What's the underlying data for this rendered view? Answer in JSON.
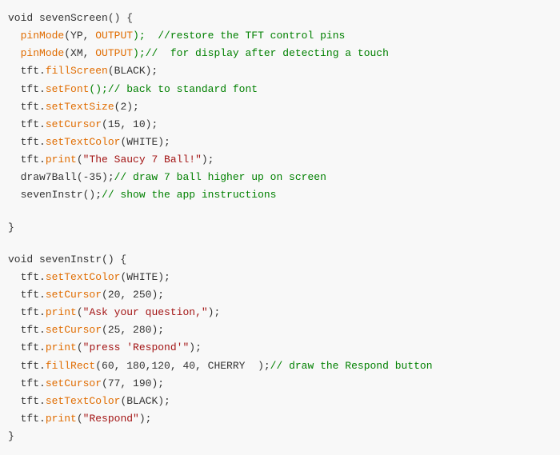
{
  "code": {
    "lines": [
      {
        "id": "l1",
        "tokens": [
          {
            "text": "void ",
            "type": "kw"
          },
          {
            "text": "sevenScreen",
            "type": "fn-name"
          },
          {
            "text": "() {",
            "type": "plain"
          }
        ]
      },
      {
        "id": "l2",
        "tokens": [
          {
            "text": "  ",
            "type": "plain"
          },
          {
            "text": "pinMode",
            "type": "method"
          },
          {
            "text": "(YP, ",
            "type": "plain"
          },
          {
            "text": "OUTPUT",
            "type": "param"
          },
          {
            "text": ");  //restore the TFT control pins",
            "type": "comment"
          }
        ]
      },
      {
        "id": "l3",
        "tokens": [
          {
            "text": "  ",
            "type": "plain"
          },
          {
            "text": "pinMode",
            "type": "method"
          },
          {
            "text": "(XM, ",
            "type": "plain"
          },
          {
            "text": "OUTPUT",
            "type": "param"
          },
          {
            "text": ");//  for display after detecting a touch",
            "type": "comment"
          }
        ]
      },
      {
        "id": "l4",
        "tokens": [
          {
            "text": "  tft.",
            "type": "plain"
          },
          {
            "text": "fillScreen",
            "type": "method"
          },
          {
            "text": "(BLACK);",
            "type": "plain"
          }
        ]
      },
      {
        "id": "l5",
        "tokens": [
          {
            "text": "  tft.",
            "type": "plain"
          },
          {
            "text": "setFont",
            "type": "method"
          },
          {
            "text": "();// back to standard font",
            "type": "comment"
          }
        ]
      },
      {
        "id": "l6",
        "tokens": [
          {
            "text": "  tft.",
            "type": "plain"
          },
          {
            "text": "setTextSize",
            "type": "method"
          },
          {
            "text": "(2);",
            "type": "plain"
          }
        ]
      },
      {
        "id": "l7",
        "tokens": [
          {
            "text": "  tft.",
            "type": "plain"
          },
          {
            "text": "setCursor",
            "type": "method"
          },
          {
            "text": "(15, 10);",
            "type": "plain"
          }
        ]
      },
      {
        "id": "l8",
        "tokens": [
          {
            "text": "  tft.",
            "type": "plain"
          },
          {
            "text": "setTextColor",
            "type": "method"
          },
          {
            "text": "(WHITE);",
            "type": "plain"
          }
        ]
      },
      {
        "id": "l9",
        "tokens": [
          {
            "text": "  tft.",
            "type": "plain"
          },
          {
            "text": "print",
            "type": "method"
          },
          {
            "text": "(",
            "type": "plain"
          },
          {
            "text": "\"The Saucy 7 Ball!\"",
            "type": "string"
          },
          {
            "text": ");",
            "type": "plain"
          }
        ]
      },
      {
        "id": "l10",
        "tokens": [
          {
            "text": "  draw7Ball(-35);// draw 7 ball higher up on screen",
            "type": "comment-mixed",
            "parts": [
              {
                "text": "  draw7Ball(-35);",
                "type": "plain"
              },
              {
                "text": "// draw 7 ball higher up on screen",
                "type": "comment"
              }
            ]
          }
        ]
      },
      {
        "id": "l11",
        "tokens": [
          {
            "text": "  sevenInstr();// show the app instructions",
            "type": "comment-mixed",
            "parts": [
              {
                "text": "  sevenInstr();",
                "type": "plain"
              },
              {
                "text": "// show the app instructions",
                "type": "comment"
              }
            ]
          }
        ]
      },
      {
        "id": "l12",
        "blank": true
      },
      {
        "id": "l13",
        "tokens": [
          {
            "text": "}",
            "type": "plain"
          }
        ]
      },
      {
        "id": "l14",
        "blank": true
      },
      {
        "id": "l15",
        "tokens": [
          {
            "text": "void ",
            "type": "kw"
          },
          {
            "text": "sevenInstr",
            "type": "fn-name"
          },
          {
            "text": "() {",
            "type": "plain"
          }
        ]
      },
      {
        "id": "l16",
        "tokens": [
          {
            "text": "  tft.",
            "type": "plain"
          },
          {
            "text": "setTextColor",
            "type": "method"
          },
          {
            "text": "(WHITE);",
            "type": "plain"
          }
        ]
      },
      {
        "id": "l17",
        "tokens": [
          {
            "text": "  tft.",
            "type": "plain"
          },
          {
            "text": "setCursor",
            "type": "method"
          },
          {
            "text": "(20, 250);",
            "type": "plain"
          }
        ]
      },
      {
        "id": "l18",
        "tokens": [
          {
            "text": "  tft.",
            "type": "plain"
          },
          {
            "text": "print",
            "type": "method"
          },
          {
            "text": "(",
            "type": "plain"
          },
          {
            "text": "\"Ask your question,\"",
            "type": "string"
          },
          {
            "text": ");",
            "type": "plain"
          }
        ]
      },
      {
        "id": "l19",
        "tokens": [
          {
            "text": "  tft.",
            "type": "plain"
          },
          {
            "text": "setCursor",
            "type": "method"
          },
          {
            "text": "(25, 280);",
            "type": "plain"
          }
        ]
      },
      {
        "id": "l20",
        "tokens": [
          {
            "text": "  tft.",
            "type": "plain"
          },
          {
            "text": "print",
            "type": "method"
          },
          {
            "text": "(",
            "type": "plain"
          },
          {
            "text": "\"press 'Respond'\"",
            "type": "string"
          },
          {
            "text": ");",
            "type": "plain"
          }
        ]
      },
      {
        "id": "l21",
        "tokens": [
          {
            "text": "  tft.",
            "type": "plain"
          },
          {
            "text": "fillRect",
            "type": "method"
          },
          {
            "text": "(60, 180,120, 40, CHERRY  );// draw the Respond button",
            "type": "comment-mixed",
            "parts": [
              {
                "text": "(60, 180,120, 40, CHERRY  );",
                "type": "plain"
              },
              {
                "text": "// draw the Respond button",
                "type": "comment"
              }
            ]
          }
        ]
      },
      {
        "id": "l22",
        "tokens": [
          {
            "text": "  tft.",
            "type": "plain"
          },
          {
            "text": "setCursor",
            "type": "method"
          },
          {
            "text": "(77, 190);",
            "type": "plain"
          }
        ]
      },
      {
        "id": "l23",
        "tokens": [
          {
            "text": "  tft.",
            "type": "plain"
          },
          {
            "text": "setTextColor",
            "type": "method"
          },
          {
            "text": "(BLACK);",
            "type": "plain"
          }
        ]
      },
      {
        "id": "l24",
        "tokens": [
          {
            "text": "  tft.",
            "type": "plain"
          },
          {
            "text": "print",
            "type": "method"
          },
          {
            "text": "(",
            "type": "plain"
          },
          {
            "text": "\"Respond\"",
            "type": "string"
          },
          {
            "text": ");",
            "type": "plain"
          }
        ]
      },
      {
        "id": "l25",
        "tokens": [
          {
            "text": "}",
            "type": "plain"
          }
        ]
      }
    ]
  }
}
